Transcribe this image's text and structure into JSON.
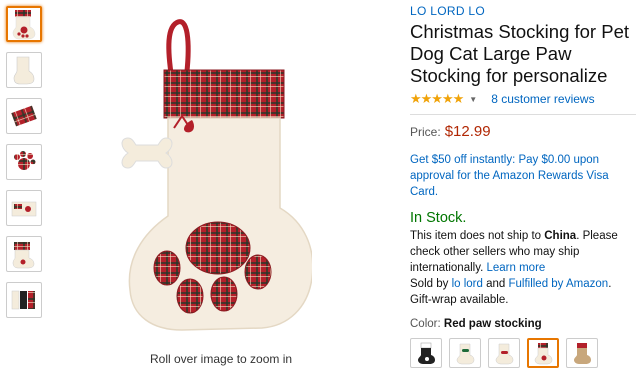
{
  "brand": "LO LORD LO",
  "title": "Christmas Stocking for Pet Dog Cat Large Paw Stocking for personalize",
  "rating": {
    "stars": "★★★★★",
    "reviews": "8 customer reviews"
  },
  "price": {
    "label": "Price:",
    "value": "$12.99"
  },
  "promo": "Get $50 off instantly: Pay $0.00 upon approval for the Amazon Rewards Visa Card.",
  "stock": "In Stock.",
  "shipping": {
    "prefix": "This item does not ship to ",
    "country": "China",
    "middle": ". Please check other sellers who may ship internationally. ",
    "learn_more": "Learn more",
    "sold_by": "Sold by ",
    "seller": "lo lord",
    "and": " and ",
    "fulfilled": "Fulfilled by Amazon",
    "period": ".",
    "gift": "Gift-wrap available."
  },
  "color": {
    "label": "Color:",
    "value": "Red paw stocking"
  },
  "zoom_hint": "Roll over image to zoom in",
  "colors": {
    "accent": "#e77600",
    "link": "#0066c0",
    "price": "#b12704",
    "stock": "#007600",
    "plaid": "#b3202a"
  }
}
